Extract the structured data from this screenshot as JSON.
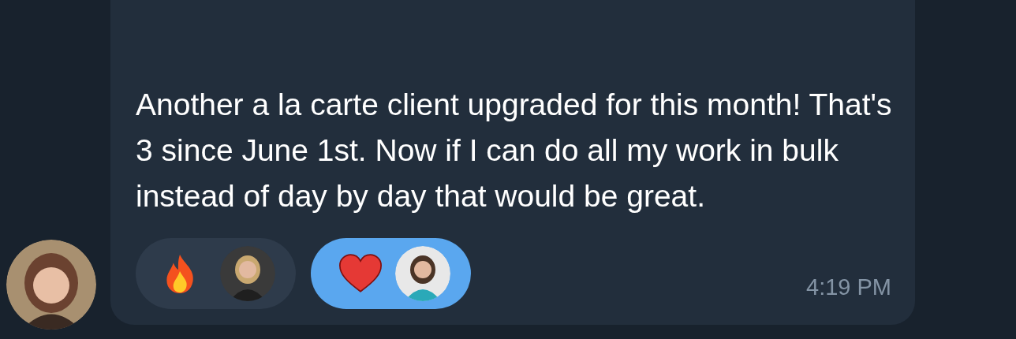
{
  "message": {
    "text": "Another a la carte client upgraded for this month! That's 3 since June 1st. Now if I can do all my work in bulk instead of day by day that would be great.",
    "time": "4:19 PM",
    "reactions": [
      {
        "kind": "fire",
        "selected": false
      },
      {
        "kind": "heart",
        "selected": true
      }
    ]
  }
}
